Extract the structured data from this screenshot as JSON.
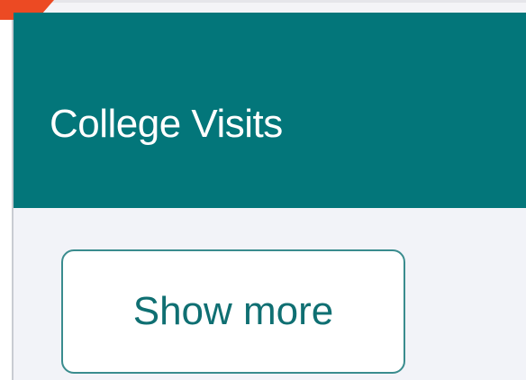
{
  "card": {
    "title": "College Visits",
    "show_more_label": "Show more"
  },
  "colors": {
    "header_bg": "#03767a",
    "body_bg": "#f2f3f8",
    "button_text": "#0f6f72",
    "button_border": "#3a8c8e",
    "accent": "#ec4a23"
  }
}
